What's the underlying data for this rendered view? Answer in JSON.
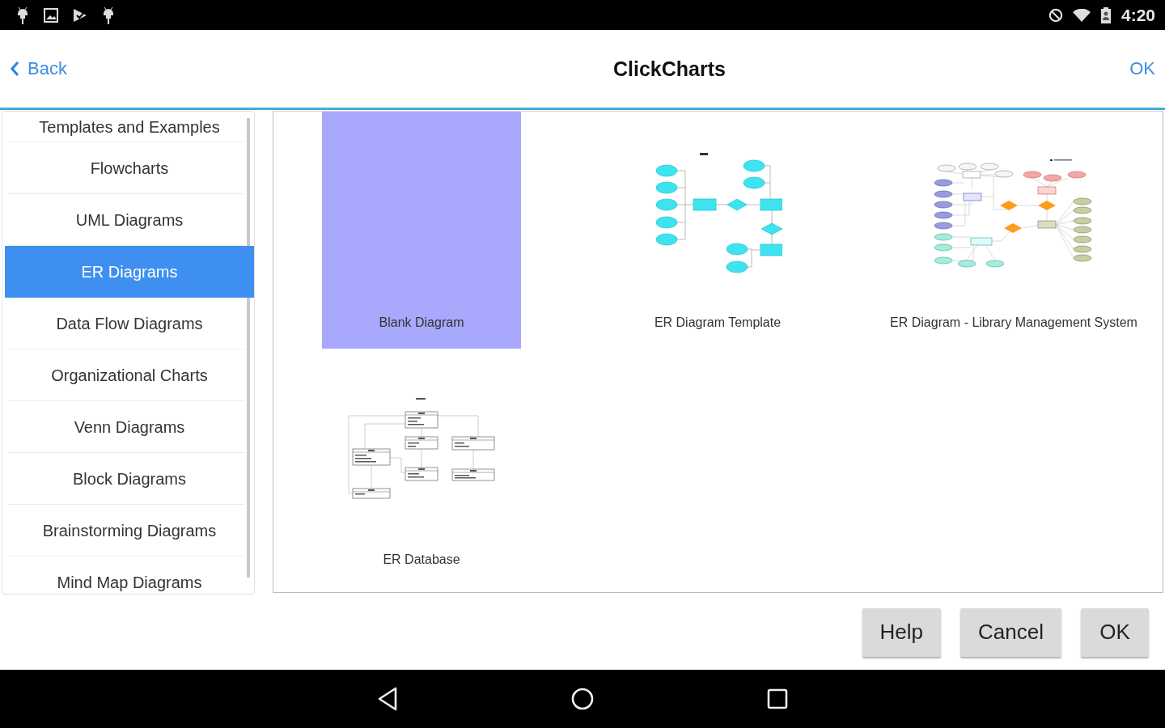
{
  "status_bar": {
    "time": "4:20"
  },
  "header": {
    "back": "Back",
    "title": "ClickCharts",
    "ok": "OK"
  },
  "sidebar": {
    "items": [
      {
        "label": "Templates and Examples",
        "selected": false
      },
      {
        "label": "Flowcharts",
        "selected": false
      },
      {
        "label": "UML Diagrams",
        "selected": false
      },
      {
        "label": "ER Diagrams",
        "selected": true
      },
      {
        "label": "Data Flow Diagrams",
        "selected": false
      },
      {
        "label": "Organizational Charts",
        "selected": false
      },
      {
        "label": "Venn Diagrams",
        "selected": false
      },
      {
        "label": "Block Diagrams",
        "selected": false
      },
      {
        "label": "Brainstorming Diagrams",
        "selected": false
      },
      {
        "label": "Mind Map Diagrams",
        "selected": false
      }
    ]
  },
  "templates": [
    {
      "name": "Blank Diagram",
      "kind": "blank",
      "selected": true
    },
    {
      "name": "ER Diagram Template",
      "kind": "er-template",
      "selected": false
    },
    {
      "name": "ER Diagram - Library Management System",
      "kind": "er-library",
      "selected": false
    },
    {
      "name": "ER Database",
      "kind": "er-database",
      "selected": false
    }
  ],
  "buttons": [
    "Help",
    "Cancel",
    "OK"
  ]
}
